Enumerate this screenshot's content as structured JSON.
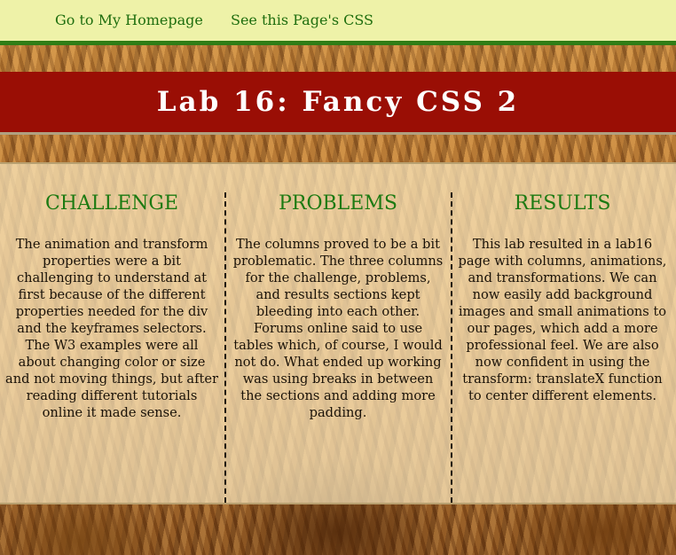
{
  "nav": {
    "home_label": "Go to My Homepage",
    "css_label": "See this Page's CSS"
  },
  "header": {
    "title": "Lab 16: Fancy CSS 2"
  },
  "columns": [
    {
      "heading": "CHALLENGE",
      "text": "The animation and transform properties were a bit challenging to understand at first because of the different properties needed for the div and the keyframes selectors. The W3 examples were all about changing color or size and not moving things, but after reading different tutorials online it made sense."
    },
    {
      "heading": "PROBLEMS",
      "text": "The columns proved to be a bit problematic. The three columns for the challenge, problems, and results sections kept bleeding into each other. Forums online said to use tables which, of course, I would not do. What ended up working was using breaks in between the sections and adding more padding."
    },
    {
      "heading": "RESULTS",
      "text": "This lab resulted in a lab16 page with columns, animations, and transformations. We can now easily add background images and small animations to our pages, which add a more professional feel. We are also now confident in using the transform: translateX function to center different elements."
    }
  ],
  "colors": {
    "nav_bg": "#eef2a8",
    "nav_link": "#1f6e0f",
    "banner_bg": "#9a0e05",
    "heading": "#1c7a12"
  }
}
